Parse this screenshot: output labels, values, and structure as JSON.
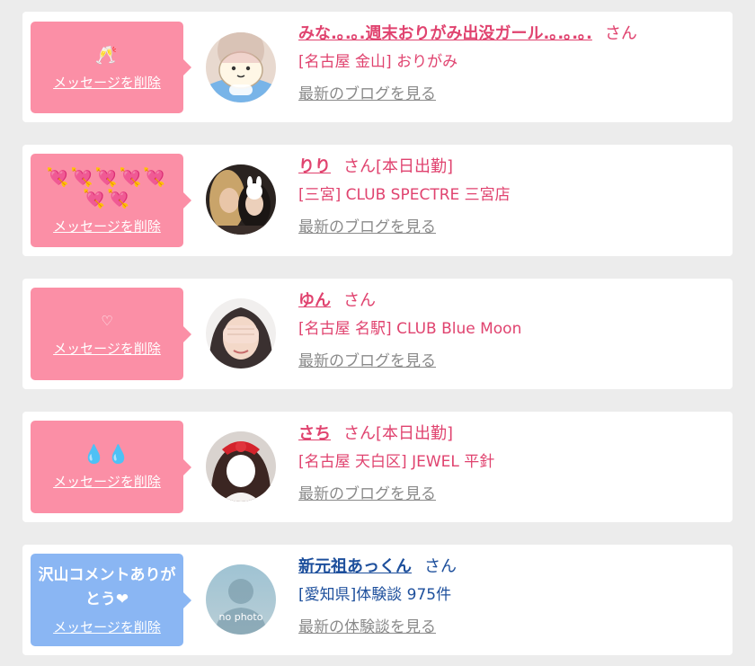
{
  "colors": {
    "page_bg": "#ececec",
    "pink_bubble": "#fb8fa6",
    "blue_bubble": "#8ab6f3",
    "pink_text": "#e0436f",
    "blue_text": "#1d4f9c",
    "link_gray": "#8a8a8a"
  },
  "items": [
    {
      "message": "🥂",
      "delete_label": "メッセージを削除",
      "avatar_icon": "character-illustration-avatar",
      "name": "みな.｡.｡.週末おりがみ出没ガール.｡.｡.｡.",
      "honorific": "さん",
      "status": "",
      "shop": "[名古屋 金山] おりがみ",
      "link": "最新のブログを見る"
    },
    {
      "message": "💘💘💘💘💘💘💘",
      "delete_label": "メッセージを削除",
      "avatar_icon": "two-women-photo-avatar",
      "name": "りり",
      "honorific": "さん",
      "status": "[本日出勤]",
      "shop": "[三宮] CLUB SPECTRE 三宮店",
      "link": "最新のブログを見る"
    },
    {
      "message": "♡",
      "delete_label": "メッセージを削除",
      "avatar_icon": "woman-covering-eyes-avatar",
      "name": "ゆん",
      "honorific": "さん",
      "status": "",
      "shop": "[名古屋 名駅] CLUB Blue Moon",
      "link": "最新のブログを見る"
    },
    {
      "message": "💧💧",
      "delete_label": "メッセージを削除",
      "avatar_icon": "woman-red-ribbon-avatar",
      "name": "さち",
      "honorific": "さん",
      "status": "[本日出勤]",
      "shop": "[名古屋 天白区] JEWEL 平針",
      "link": "最新のブログを見る"
    },
    {
      "message": "沢山コメントありがとう❤",
      "delete_label": "メッセージを削除",
      "avatar_icon": "no-photo-silhouette-avatar",
      "avatar_text": "no photo",
      "name": "新元祖あっくん",
      "honorific": "さん",
      "status": "",
      "shop": "[愛知県]体験談 975件",
      "link": "最新の体験談を見る"
    }
  ]
}
